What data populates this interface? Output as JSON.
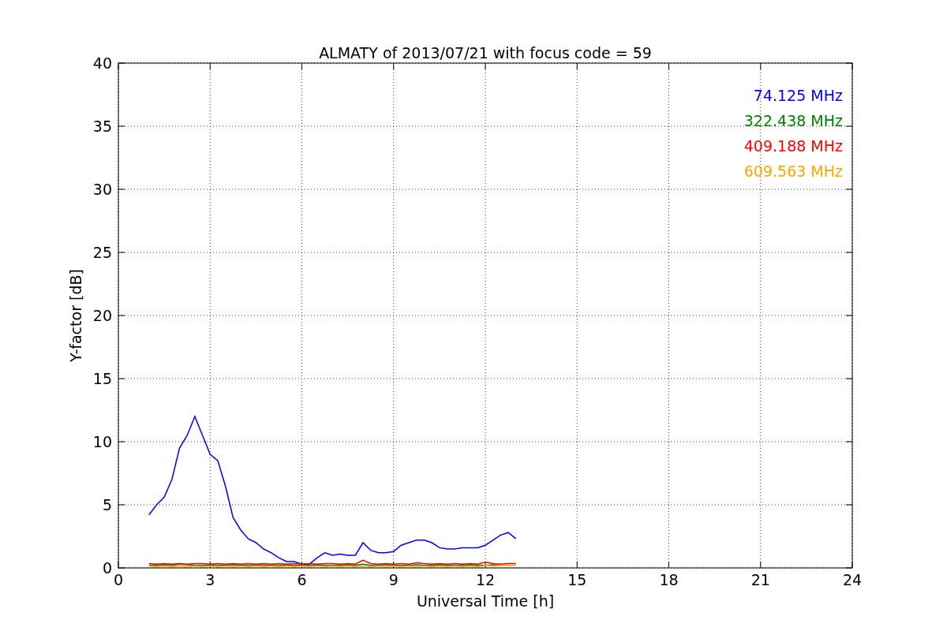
{
  "figure": {
    "chart_data": {
      "type": "line",
      "title": "ALMATY of 2013/07/21 with focus code = 59",
      "xlabel": "Universal Time [h]",
      "ylabel": "Y-factor [dB]",
      "x": [
        1,
        1.25,
        1.5,
        1.75,
        2,
        2.25,
        2.5,
        2.75,
        3,
        3.25,
        3.5,
        3.75,
        4,
        4.25,
        4.5,
        4.75,
        5,
        5.25,
        5.5,
        5.75,
        6,
        6.25,
        6.5,
        6.75,
        7,
        7.25,
        7.5,
        7.75,
        8,
        8.25,
        8.5,
        8.75,
        9,
        9.25,
        9.5,
        9.75,
        10,
        10.25,
        10.5,
        10.75,
        11,
        11.25,
        11.5,
        11.75,
        12,
        12.25,
        12.5,
        12.75,
        13
      ],
      "series": [
        {
          "name": "74.125 MHz",
          "color": "#0000ff",
          "values": [
            4.2,
            5,
            5.6,
            7,
            9.5,
            10.5,
            12,
            10.5,
            9,
            8.5,
            6.5,
            4,
            3,
            2.3,
            2,
            1.5,
            1.2,
            0.8,
            0.5,
            0.5,
            0.3,
            0.3,
            0.8,
            1.2,
            1,
            1.1,
            1,
            1,
            2,
            1.4,
            1.2,
            1.2,
            1.3,
            1.8,
            2,
            2.2,
            2.2,
            2,
            1.6,
            1.5,
            1.5,
            1.6,
            1.6,
            1.6,
            1.8,
            2.2,
            2.6,
            2.8,
            2.3
          ]
        },
        {
          "name": "322.438 MHz",
          "color": "#008000",
          "values": [
            0.2,
            0.2,
            0.25,
            0.2,
            0.3,
            0.25,
            0.2,
            0.2,
            0.25,
            0.2,
            0.2,
            0.25,
            0.2,
            0.2,
            0.25,
            0.2,
            0.2,
            0.2,
            0.25,
            0.2,
            0.2,
            0.2,
            0.25,
            0.2,
            0.2,
            0.2,
            0.25,
            0.2,
            0.3,
            0.2,
            0.2,
            0.25,
            0.2,
            0.2,
            0.2,
            0.25,
            0.2,
            0.2,
            0.25,
            0.2,
            0.2,
            0.2,
            0.25,
            0.2,
            0.2,
            0.25,
            0.2,
            null,
            null
          ]
        },
        {
          "name": "409.188 MHz",
          "color": "#ff0000",
          "values": [
            0.35,
            0.3,
            0.35,
            0.3,
            0.35,
            0.3,
            0.35,
            0.35,
            0.3,
            0.35,
            0.3,
            0.35,
            0.3,
            0.35,
            0.3,
            0.35,
            0.3,
            0.35,
            0.3,
            0.35,
            0.3,
            0.35,
            0.3,
            0.35,
            0.35,
            0.3,
            0.35,
            0.3,
            0.6,
            0.35,
            0.3,
            0.35,
            0.3,
            0.35,
            0.3,
            0.4,
            0.35,
            0.3,
            0.35,
            0.3,
            0.35,
            0.3,
            0.35,
            0.3,
            0.45,
            0.35,
            0.3,
            0.35,
            0.35
          ]
        },
        {
          "name": "609.563 MHz",
          "color": "#ffa500",
          "values": [
            0.15,
            0.1,
            0.15,
            0.1,
            0.15,
            0.1,
            0.15,
            0.1,
            0.15,
            0.1,
            0.15,
            0.1,
            0.15,
            0.1,
            0.15,
            0.1,
            0.15,
            0.1,
            0.15,
            0.1,
            0.15,
            0.1,
            0.15,
            0.1,
            0.15,
            0.1,
            0.15,
            0.1,
            0.15,
            0.1,
            0.15,
            0.1,
            0.15,
            0.1,
            0.15,
            0.1,
            0.15,
            0.1,
            0.15,
            0.1,
            0.15,
            0.1,
            0.15,
            0.1,
            0.2,
            0.15,
            0.2,
            0.2,
            0.2
          ]
        }
      ],
      "grid": true,
      "xlim": [
        0,
        24
      ],
      "ylim": [
        0,
        40
      ],
      "xticks": [
        0,
        3,
        6,
        9,
        12,
        15,
        18,
        21,
        24
      ],
      "yticks": [
        0,
        5,
        10,
        15,
        20,
        25,
        30,
        35,
        40
      ]
    }
  }
}
